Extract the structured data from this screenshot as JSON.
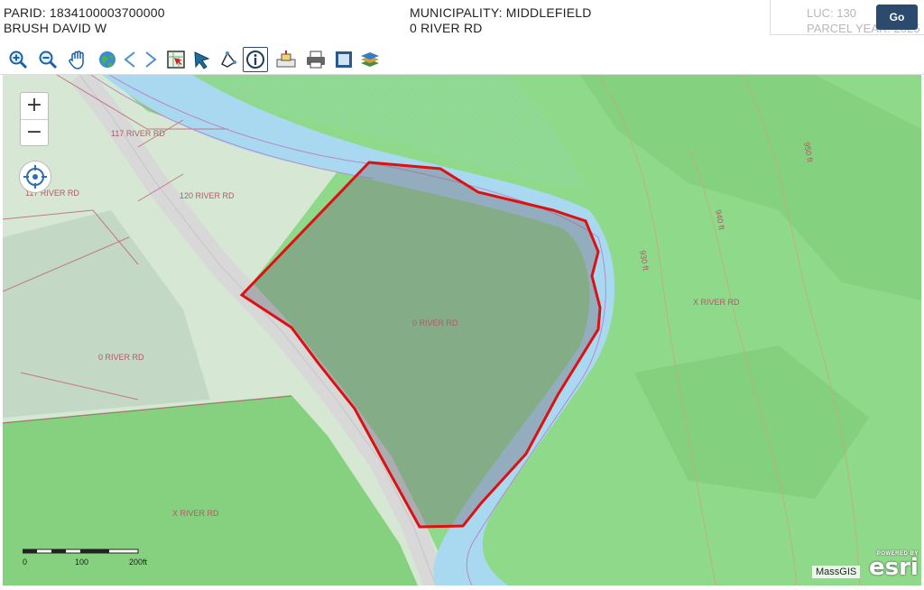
{
  "header": {
    "parid": "PARID: 1834100003700000",
    "owner": "BRUSH DAVID W",
    "municipality": "MUNICIPALITY: MIDDLEFIELD",
    "address": "0 RIVER RD",
    "luc": "LUC: 130",
    "parcel_year": "PARCEL YEAR: 2025",
    "go_label": "Go"
  },
  "toolbar": {
    "tools": [
      "zoom-in-icon",
      "zoom-out-icon",
      "pan-hand-icon",
      "globe-icon",
      "previous-extent-icon",
      "next-extent-icon",
      "select-parcel-icon",
      "select-arrow-icon",
      "measure-icon",
      "identify-info-icon",
      "buffer-icon",
      "print-icon",
      "full-extent-icon",
      "layers-icon"
    ],
    "active_tool": "identify-info-icon"
  },
  "map": {
    "zoom_in_label": "+",
    "zoom_out_label": "−",
    "parcel_labels": {
      "p117a": "117 RIVER RD",
      "p117b": "117 RIVER RD",
      "p120": "120 RIVER RD",
      "p0main": "0 RIVER RD",
      "p0west": "0 RIVER RD",
      "xa": "X RIVER RD",
      "xb": "X RIVER RD"
    },
    "contour_labels": {
      "c1": "950 ft",
      "c2": "940 ft",
      "c3": "930 ft"
    },
    "scale": {
      "l0": "0",
      "l1": "100",
      "l2": "200ft"
    },
    "attribution": "MassGIS",
    "esri_powered": "POWERED BY",
    "esri_name": "esri",
    "colors": {
      "selected_parcel_outline": "#dd1111",
      "river": "#a9d9f0",
      "forest": "#8fd98a"
    }
  }
}
